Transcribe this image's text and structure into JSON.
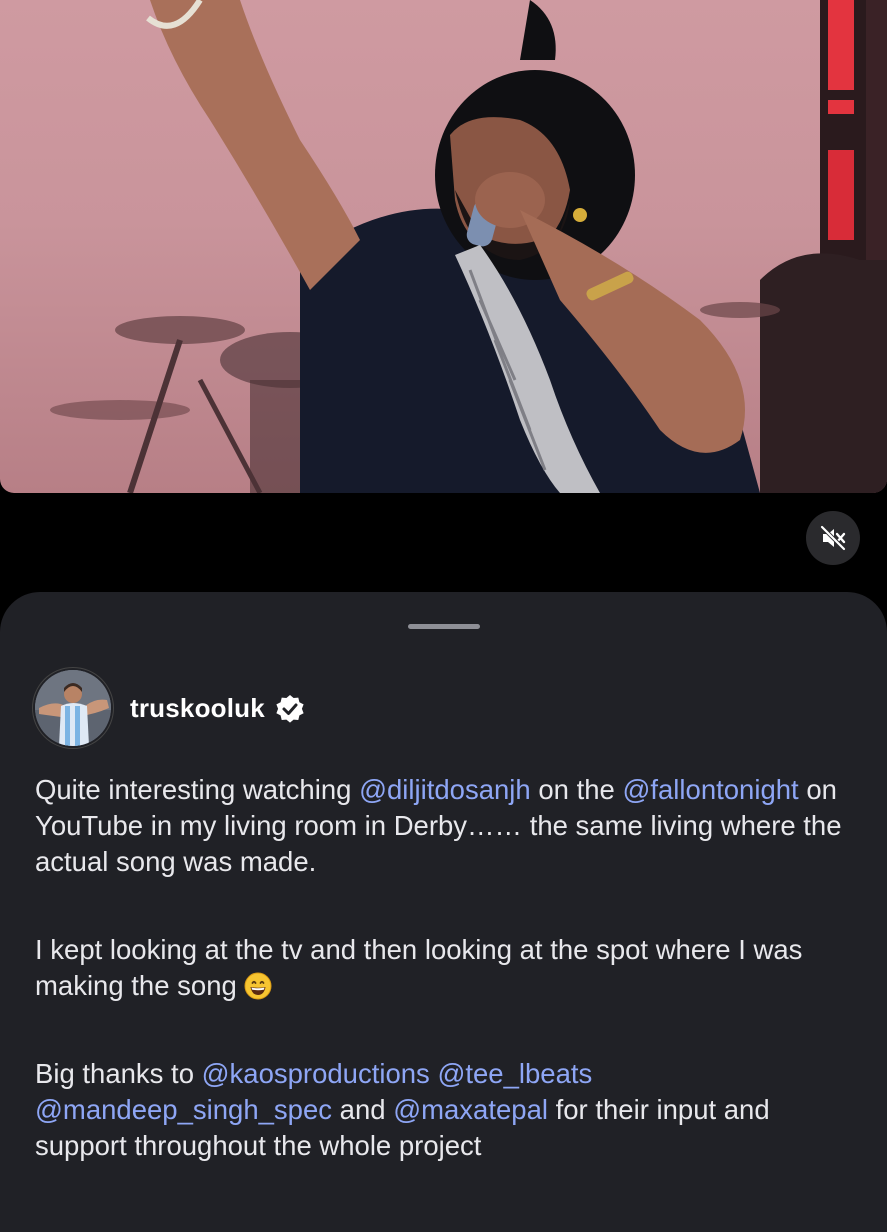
{
  "video": {
    "description_icon": "performer-video-frame",
    "mute_icon": "speaker-muted-icon"
  },
  "post": {
    "username": "truskooluk",
    "verified_icon": "verified-badge-icon",
    "paragraph1": {
      "t1": "Quite interesting watching ",
      "m1": "@diljitdosanjh",
      "t2": " on the ",
      "m2": "@fallontonight",
      "t3": " on YouTube in my living room in Derby……  the same living where the actual song was made."
    },
    "paragraph2": {
      "t1": "I kept looking at the tv and then looking at the spot where I was making the song ",
      "emoji": "grinning-face-emoji"
    },
    "paragraph3": {
      "t1": "Big thanks to ",
      "m1": "@kaosproductions",
      "t2": " ",
      "m2": "@tee_lbeats",
      "t3": " ",
      "m3": "@mandeep_singh_spec",
      "t4": " and ",
      "m4": "@maxatepal",
      "t5": " for their input and support throughout the whole project"
    }
  },
  "colors": {
    "sheet_bg": "#202126",
    "mention": "#8ea6f5",
    "verified": "#3897f0"
  }
}
